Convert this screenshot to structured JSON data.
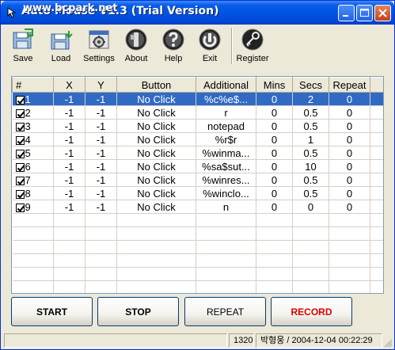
{
  "window": {
    "title": "Auto Mouse V1.3 (Trial Version)",
    "watermark": "www.bcpark.net"
  },
  "toolbar": {
    "items": [
      {
        "label": "Save",
        "icon": "save-icon"
      },
      {
        "label": "Load",
        "icon": "load-icon"
      },
      {
        "label": "Settings",
        "icon": "settings-icon"
      },
      {
        "label": "About",
        "icon": "about-icon"
      },
      {
        "label": "Help",
        "icon": "help-icon"
      },
      {
        "label": "Exit",
        "icon": "exit-icon"
      },
      {
        "label": "Register",
        "icon": "register-icon"
      }
    ]
  },
  "grid": {
    "columns": [
      "#",
      "X",
      "Y",
      "Button",
      "Additional",
      "Mins",
      "Secs",
      "Repeat"
    ],
    "rows": [
      {
        "num": "1",
        "x": "-1",
        "y": "-1",
        "button": "No Click",
        "additional": "%c%e$...",
        "mins": "0",
        "secs": "2",
        "repeat": "0",
        "selected": true
      },
      {
        "num": "2",
        "x": "-1",
        "y": "-1",
        "button": "No Click",
        "additional": "r",
        "mins": "0",
        "secs": "0.5",
        "repeat": "0"
      },
      {
        "num": "3",
        "x": "-1",
        "y": "-1",
        "button": "No Click",
        "additional": "notepad",
        "mins": "0",
        "secs": "0.5",
        "repeat": "0"
      },
      {
        "num": "4",
        "x": "-1",
        "y": "-1",
        "button": "No Click",
        "additional": "%r$r",
        "mins": "0",
        "secs": "1",
        "repeat": "0"
      },
      {
        "num": "5",
        "x": "-1",
        "y": "-1",
        "button": "No Click",
        "additional": "%winma...",
        "mins": "0",
        "secs": "0.5",
        "repeat": "0"
      },
      {
        "num": "6",
        "x": "-1",
        "y": "-1",
        "button": "No Click",
        "additional": "%sa$sut...",
        "mins": "0",
        "secs": "10",
        "repeat": "0"
      },
      {
        "num": "7",
        "x": "-1",
        "y": "-1",
        "button": "No Click",
        "additional": "%winres...",
        "mins": "0",
        "secs": "0.5",
        "repeat": "0"
      },
      {
        "num": "8",
        "x": "-1",
        "y": "-1",
        "button": "No Click",
        "additional": "%winclo...",
        "mins": "0",
        "secs": "0.5",
        "repeat": "0"
      },
      {
        "num": "9",
        "x": "-1",
        "y": "-1",
        "button": "No Click",
        "additional": "n",
        "mins": "0",
        "secs": "0",
        "repeat": "0"
      }
    ]
  },
  "buttons": {
    "start": "START",
    "stop": "STOP",
    "repeat": "REPEAT",
    "record": "RECORD"
  },
  "status": {
    "coords": "1320",
    "info": "박형웅 / 2004-12-04 00:22:29"
  },
  "colors": {
    "selection": "#316ac5",
    "record_text": "#e00000",
    "titlebar": "#0055e5"
  }
}
